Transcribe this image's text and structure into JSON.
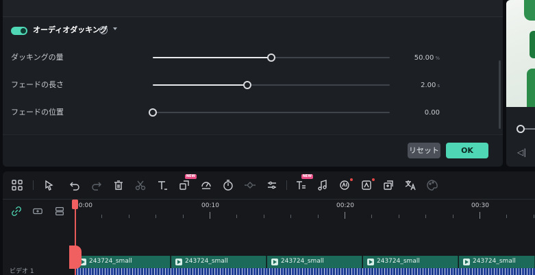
{
  "audio_ducking": {
    "enabled": true,
    "title": "オーディオダッキング",
    "help_icon": "question-circle-icon",
    "caret_icon": "caret-down-icon",
    "rows": [
      {
        "label": "ダッキングの量",
        "value": "50.00",
        "unit": "%",
        "level": 0.5
      },
      {
        "label": "フェードの長さ",
        "value": "2.00",
        "unit": "s",
        "level": 0.4
      },
      {
        "label": "フェードの位置",
        "value": "0.00",
        "unit": "",
        "level": 0.0
      }
    ],
    "reset_label": "リセット",
    "ok_label": "OK"
  },
  "colors": {
    "accent": "#4fd6b4",
    "panel_bg": "#1c1f24",
    "clip": "#1c6b5a",
    "playhead": "#f06060",
    "badge": "#e84d86"
  },
  "toolbar": {
    "new_badge": "NEW",
    "tools": [
      "layout-grid-icon",
      "select-arrow-icon",
      "undo-icon",
      "redo-icon",
      "delete-icon",
      "cut-icon",
      "text-icon",
      "crop-icon",
      "speed-icon",
      "timer-icon",
      "keyframe-icon",
      "adjust-icon",
      "ai-text-icon",
      "music-icon",
      "ai-portrait-icon",
      "ai-mask-icon",
      "replace-icon",
      "translate-icon",
      "palette-icon"
    ]
  },
  "track_head": {
    "icons": [
      "link-icon",
      "linked-clip-icon",
      "track-settings-icon"
    ],
    "track_label": "ビデオ 1"
  },
  "ruler": {
    "labels": [
      "00:00",
      "00:10",
      "00:20",
      "00:30"
    ]
  },
  "clips": [
    {
      "name": "243724_small"
    },
    {
      "name": "243724_small"
    },
    {
      "name": "243724_small"
    },
    {
      "name": "243724_small"
    },
    {
      "name": "243724_small"
    }
  ]
}
